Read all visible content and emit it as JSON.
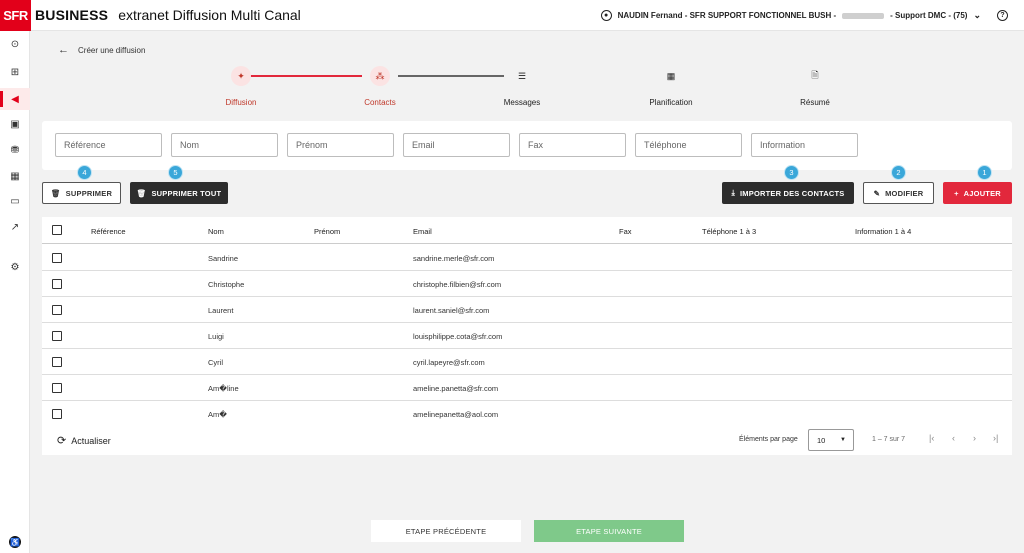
{
  "header": {
    "logo": "SFR",
    "brand": "BUSINESS",
    "app_title": "extranet Diffusion Multi Canal",
    "user_prefix": "NAUDIN Fernand - SFR SUPPORT FONCTIONNEL BUSH -",
    "user_suffix": "- Support DMC - (75)",
    "help_icon": "help-circle-icon"
  },
  "sidebar": {
    "items": [
      {
        "icon": "arrow-circle-icon",
        "glyph": "⊙"
      },
      {
        "icon": "layout-icon",
        "glyph": "⊞"
      },
      {
        "icon": "megaphone-icon",
        "glyph": "📢"
      },
      {
        "icon": "contact-card-icon",
        "glyph": "▣"
      },
      {
        "icon": "stamp-icon",
        "glyph": "⛃"
      },
      {
        "icon": "calendar-clock-icon",
        "glyph": "▦"
      },
      {
        "icon": "chat-icon",
        "glyph": "▭"
      },
      {
        "icon": "trend-icon",
        "glyph": "↗"
      },
      {
        "icon": "settings-shield-icon",
        "glyph": "⚙"
      }
    ],
    "footer_icon": "accessibility-icon"
  },
  "back_label": "Créer une diffusion",
  "stepper": {
    "steps": [
      {
        "label": "Diffusion",
        "state": "done",
        "glyph": "📢"
      },
      {
        "label": "Contacts",
        "state": "current",
        "glyph": "👥"
      },
      {
        "label": "Messages",
        "state": "todo",
        "glyph": "☰"
      },
      {
        "label": "Planification",
        "state": "todo",
        "glyph": "▦"
      },
      {
        "label": "Résumé",
        "state": "todo",
        "glyph": "🗎"
      }
    ],
    "active_color": "#e2283c",
    "inactive_color": "#555555"
  },
  "filters": {
    "placeholders": [
      "Référence",
      "Nom",
      "Prénom",
      "Email",
      "Fax",
      "Téléphone",
      "Information"
    ]
  },
  "actions": {
    "supprimer": "SUPPRIMER",
    "supprimer_tout": "SUPPRIMER TOUT",
    "importer": "IMPORTER DES CONTACTS",
    "modifier": "MODIFIER",
    "ajouter": "AJOUTER",
    "badges": {
      "supprimer": "4",
      "supprimer_tout": "5",
      "importer": "3",
      "modifier": "2",
      "ajouter": "1"
    }
  },
  "table": {
    "headers": {
      "reference": "Référence",
      "nom": "Nom",
      "prenom": "Prénom",
      "email": "Email",
      "fax": "Fax",
      "telephone": "Téléphone 1 à 3",
      "information": "Information 1 à 4"
    },
    "rows": [
      {
        "nom": "Sandrine",
        "email": "sandrine.merle@sfr.com"
      },
      {
        "nom": "Christophe",
        "email": "christophe.filbien@sfr.com"
      },
      {
        "nom": "Laurent",
        "email": "laurent.saniel@sfr.com"
      },
      {
        "nom": "Luigi",
        "email": "louisphilippe.cota@sfr.com"
      },
      {
        "nom": "Cyril",
        "email": "cyril.lapeyre@sfr.com"
      },
      {
        "nom": "Am�line",
        "email": "ameline.panetta@sfr.com"
      },
      {
        "nom": "Am�",
        "email": "amelinepanetta@aol.com"
      }
    ],
    "refresh": "Actualiser",
    "pagination": {
      "label": "Éléments par page",
      "per_page": "10",
      "range": "1 – 7 sur 7"
    }
  },
  "footer": {
    "prev": "ETAPE PRÉCÉDENTE",
    "next": "ETAPE SUIVANTE",
    "next_color": "#7fc98a"
  }
}
